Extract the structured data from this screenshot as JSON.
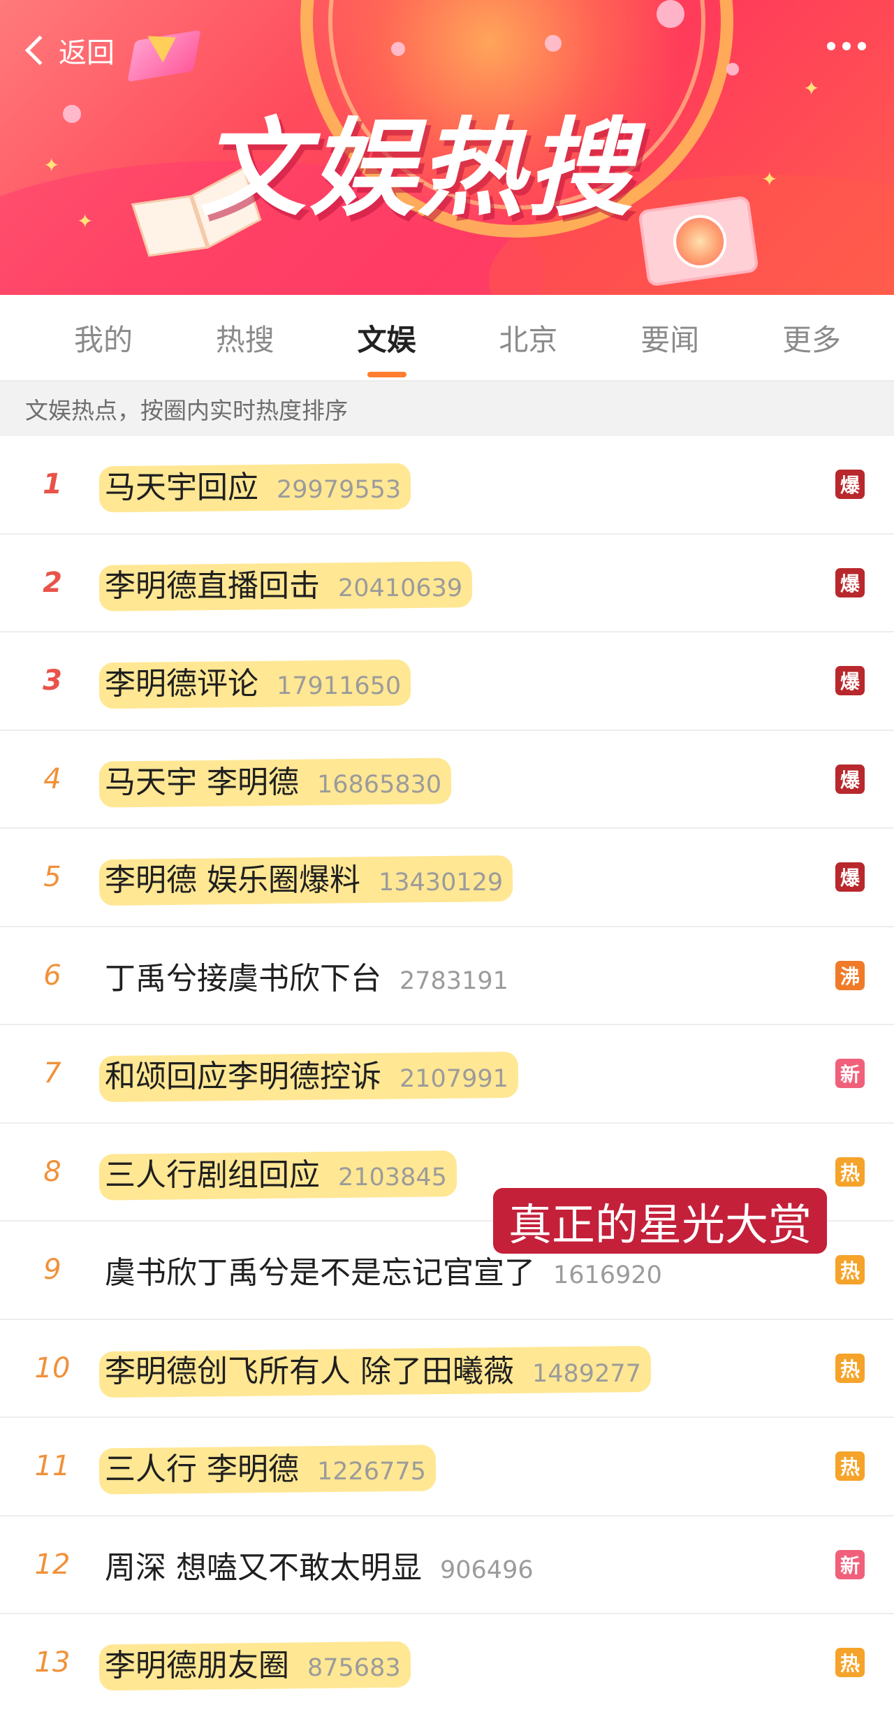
{
  "header": {
    "back_label": "返回",
    "banner_title": "文娱热搜"
  },
  "tabs": [
    {
      "label": "我的",
      "active": false
    },
    {
      "label": "热搜",
      "active": false
    },
    {
      "label": "文娱",
      "active": true
    },
    {
      "label": "北京",
      "active": false
    },
    {
      "label": "要闻",
      "active": false
    },
    {
      "label": "更多",
      "active": false
    }
  ],
  "subheader": "文娱热点，按圈内实时热度排序",
  "colors": {
    "accent": "#ff7d2e",
    "badge_bao": "#b8282c",
    "badge_fei": "#f07a28",
    "badge_xin": "#f0607a",
    "badge_re": "#f5a32a",
    "highlight": "#ffd646",
    "caption_bg": "#c4203a"
  },
  "list": [
    {
      "rank": "1",
      "title": "马天宇回应",
      "heat": "29979553",
      "badge": "爆",
      "badge_type": "bao",
      "highlighted": true
    },
    {
      "rank": "2",
      "title": "李明德直播回击",
      "heat": "20410639",
      "badge": "爆",
      "badge_type": "bao",
      "highlighted": true
    },
    {
      "rank": "3",
      "title": "李明德评论",
      "heat": "17911650",
      "badge": "爆",
      "badge_type": "bao",
      "highlighted": true
    },
    {
      "rank": "4",
      "title": "马天宇 李明德",
      "heat": "16865830",
      "badge": "爆",
      "badge_type": "bao",
      "highlighted": true
    },
    {
      "rank": "5",
      "title": "李明德 娱乐圈爆料",
      "heat": "13430129",
      "badge": "爆",
      "badge_type": "bao",
      "highlighted": true
    },
    {
      "rank": "6",
      "title": "丁禹兮接虞书欣下台",
      "heat": "2783191",
      "badge": "沸",
      "badge_type": "fei",
      "highlighted": false
    },
    {
      "rank": "7",
      "title": "和颂回应李明德控诉",
      "heat": "2107991",
      "badge": "新",
      "badge_type": "xin",
      "highlighted": true
    },
    {
      "rank": "8",
      "title": "三人行剧组回应",
      "heat": "2103845",
      "badge": "热",
      "badge_type": "re",
      "highlighted": true
    },
    {
      "rank": "9",
      "title": "虞书欣丁禹兮是不是忘记官宣了",
      "heat": "1616920",
      "badge": "热",
      "badge_type": "re",
      "highlighted": false
    },
    {
      "rank": "10",
      "title": "李明德创飞所有人 除了田曦薇",
      "heat": "1489277",
      "badge": "热",
      "badge_type": "re",
      "highlighted": true
    },
    {
      "rank": "11",
      "title": "三人行 李明德",
      "heat": "1226775",
      "badge": "热",
      "badge_type": "re",
      "highlighted": true
    },
    {
      "rank": "12",
      "title": "周深 想嗑又不敢太明显",
      "heat": "906496",
      "badge": "新",
      "badge_type": "xin",
      "highlighted": false
    },
    {
      "rank": "13",
      "title": "李明德朋友圈",
      "heat": "875683",
      "badge": "热",
      "badge_type": "re",
      "highlighted": true
    }
  ],
  "overlay_caption": "真正的星光大赏"
}
